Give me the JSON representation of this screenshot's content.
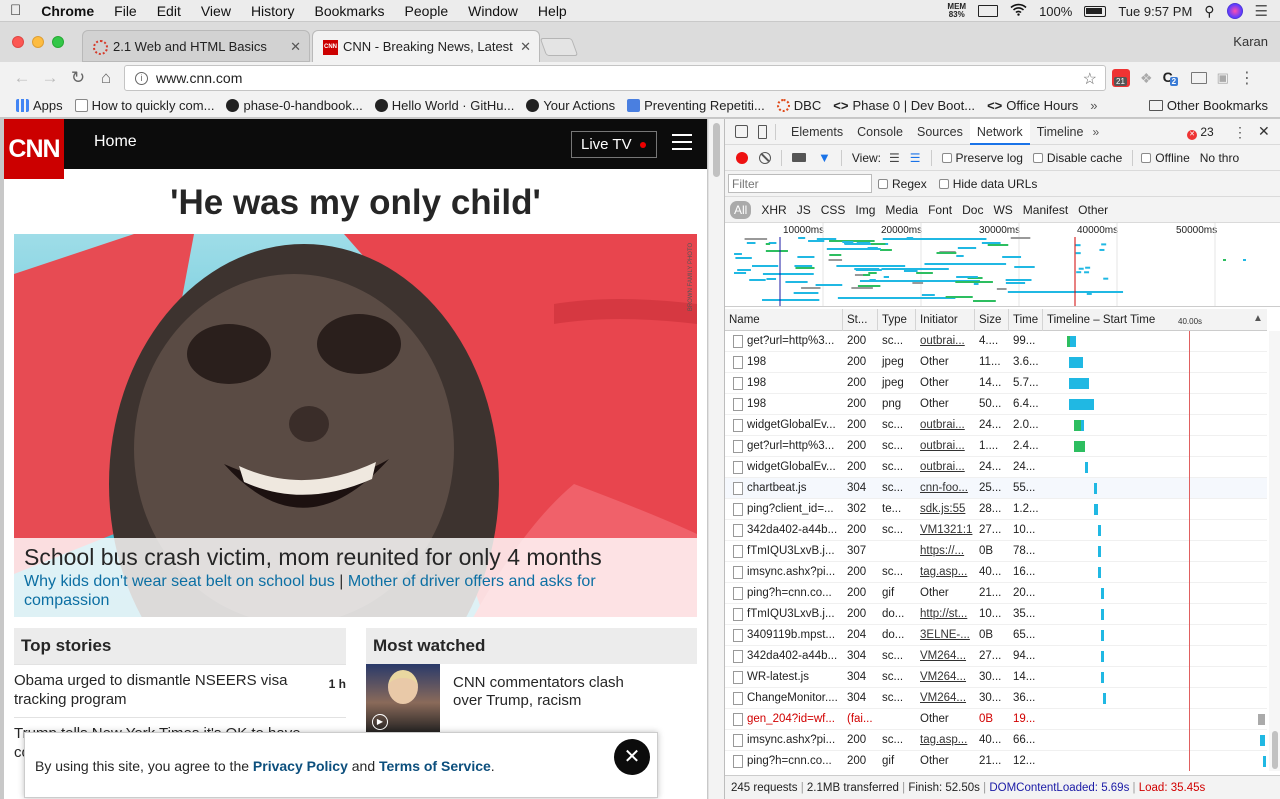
{
  "mac_menu": {
    "app": "Chrome",
    "items": [
      "File",
      "Edit",
      "View",
      "History",
      "Bookmarks",
      "People",
      "Window",
      "Help"
    ],
    "mem_label": "MEM",
    "mem_value": "83%",
    "battery": "100%",
    "clock": "Tue 9:57 PM"
  },
  "tabs": [
    {
      "title": "2.1 Web and HTML Basics",
      "active": false
    },
    {
      "title": "CNN - Breaking News, Latest N",
      "active": true
    }
  ],
  "profile_name": "Karan",
  "address": {
    "url": "www.cnn.com"
  },
  "extensions": {
    "badge_count": "21",
    "second_badge": "2"
  },
  "bookmarks": [
    {
      "label": "Apps",
      "icon": "apps-grid-icon",
      "color": "#4285f4"
    },
    {
      "label": "How to quickly com...",
      "icon": "doc-icon",
      "color": "#888888"
    },
    {
      "label": "phase-0-handbook...",
      "icon": "github-icon",
      "color": "#222222"
    },
    {
      "label": "Hello World · GitHu...",
      "icon": "github-icon",
      "color": "#222222"
    },
    {
      "label": "Your Actions",
      "icon": "github-icon",
      "color": "#222222"
    },
    {
      "label": "Preventing Repetiti...",
      "icon": "google-doc-icon",
      "color": "#4a7fe0"
    },
    {
      "label": "DBC",
      "icon": "dbc-icon",
      "color": "#e04a1a"
    },
    {
      "label": "Phase 0 | Dev Boot...",
      "icon": "code-icon",
      "color": "#333333"
    },
    {
      "label": "Office Hours",
      "icon": "code-icon",
      "color": "#333333"
    }
  ],
  "other_bookmarks": "Other Bookmarks",
  "cnn": {
    "logo": "CNN",
    "nav_home": "Home",
    "live_tv": "Live TV",
    "headline": "'He was my only child'",
    "photo_credit": "BROWN FAMILY PHOTO",
    "caption_title": "School bus crash victim, mom reunited for only 4 months",
    "caption_link1": "Why kids don't wear seat belt on school bus",
    "caption_sep": "|",
    "caption_link2": "Mother of driver offers and asks for compassion",
    "top_stories_title": "Top stories",
    "most_watched_title": "Most watched",
    "stories": [
      {
        "text": "Obama urged to dismantle NSEERS visa tracking program",
        "time": "1 h"
      },
      {
        "text": "Trump tells New York Times it's OK to have co...",
        "time": ""
      }
    ],
    "watched": [
      {
        "text": "CNN commentators clash over Trump, racism"
      }
    ],
    "cookie_prefix": "By using this site, you agree to the ",
    "cookie_policy": "Privacy Policy",
    "cookie_and": " and ",
    "cookie_terms": "Terms of Service",
    "cookie_suffix": "."
  },
  "devtools": {
    "tabs": [
      "Elements",
      "Console",
      "Sources",
      "Network",
      "Timeline"
    ],
    "active_tab": "Network",
    "error_count": "23",
    "view_label": "View:",
    "preserve_log": "Preserve log",
    "disable_cache": "Disable cache",
    "offline": "Offline",
    "throttle": "No thro",
    "filter_placeholder": "Filter",
    "regex": "Regex",
    "hide_data_urls": "Hide data URLs",
    "types": [
      "All",
      "XHR",
      "JS",
      "CSS",
      "Img",
      "Media",
      "Font",
      "Doc",
      "WS",
      "Manifest",
      "Other"
    ],
    "overview_ticks": [
      "10000ms",
      "20000ms",
      "30000ms",
      "40000ms",
      "50000ms"
    ],
    "columns": [
      "Name",
      "St...",
      "Type",
      "Initiator",
      "Size",
      "Time",
      "Timeline – Start Time"
    ],
    "timeline_marker": "40.00s",
    "requests": [
      {
        "name": "get?url=http%3...",
        "status": "200",
        "type": "sc...",
        "initiator": "outbrai...",
        "link": true,
        "size": "4....",
        "time": "99...",
        "wf": [
          {
            "s": 0.11,
            "w": 0.03,
            "c": "#20b8e3"
          },
          {
            "s": 0.1,
            "w": 0.01,
            "c": "#2dbe60"
          }
        ]
      },
      {
        "name": "198",
        "status": "200",
        "type": "jpeg",
        "initiator": "Other",
        "link": false,
        "size": "11...",
        "time": "3.6...",
        "wf": [
          {
            "s": 0.11,
            "w": 0.06,
            "c": "#20b8e3"
          }
        ]
      },
      {
        "name": "198",
        "status": "200",
        "type": "jpeg",
        "initiator": "Other",
        "link": false,
        "size": "14...",
        "time": "5.7...",
        "wf": [
          {
            "s": 0.11,
            "w": 0.09,
            "c": "#20b8e3"
          }
        ]
      },
      {
        "name": "198",
        "status": "200",
        "type": "png",
        "initiator": "Other",
        "link": false,
        "size": "50...",
        "time": "6.4...",
        "wf": [
          {
            "s": 0.11,
            "w": 0.11,
            "c": "#20b8e3"
          }
        ]
      },
      {
        "name": "widgetGlobalEv...",
        "status": "200",
        "type": "sc...",
        "initiator": "outbrai...",
        "link": true,
        "size": "24...",
        "time": "2.0...",
        "wf": [
          {
            "s": 0.13,
            "w": 0.03,
            "c": "#2dbe60"
          },
          {
            "s": 0.16,
            "w": 0.01,
            "c": "#20b8e3"
          }
        ]
      },
      {
        "name": "get?url=http%3...",
        "status": "200",
        "type": "sc...",
        "initiator": "outbrai...",
        "link": true,
        "size": "1....",
        "time": "2.4...",
        "wf": [
          {
            "s": 0.13,
            "w": 0.05,
            "c": "#2dbe60"
          }
        ]
      },
      {
        "name": "widgetGlobalEv...",
        "status": "200",
        "type": "sc...",
        "initiator": "outbrai...",
        "link": true,
        "size": "24...",
        "time": "24...",
        "wf": [
          {
            "s": 0.18,
            "w": 0.01,
            "c": "#20b8e3"
          }
        ]
      },
      {
        "name": "chartbeat.js",
        "status": "304",
        "type": "sc...",
        "initiator": "cnn-foo...",
        "link": true,
        "size": "25...",
        "time": "55...",
        "wf": [
          {
            "s": 0.22,
            "w": 0.01,
            "c": "#20b8e3"
          }
        ]
      },
      {
        "name": "ping?client_id=...",
        "status": "302",
        "type": "te...",
        "initiator": "sdk.js:55",
        "link": true,
        "size": "28...",
        "time": "1.2...",
        "wf": [
          {
            "s": 0.22,
            "w": 0.02,
            "c": "#20b8e3"
          }
        ]
      },
      {
        "name": "342da402-a44b...",
        "status": "200",
        "type": "sc...",
        "initiator": "VM1321:1",
        "link": true,
        "size": "27...",
        "time": "10...",
        "wf": [
          {
            "s": 0.24,
            "w": 0.01,
            "c": "#20b8e3"
          }
        ]
      },
      {
        "name": "fTmIQU3LxvB.j...",
        "status": "307",
        "type": "",
        "initiator": "https://...",
        "link": true,
        "size": "0B",
        "time": "78...",
        "wf": [
          {
            "s": 0.24,
            "w": 0.01,
            "c": "#20b8e3"
          }
        ]
      },
      {
        "name": "imsync.ashx?pi...",
        "status": "200",
        "type": "sc...",
        "initiator": "tag.asp...",
        "link": true,
        "size": "40...",
        "time": "16...",
        "wf": [
          {
            "s": 0.24,
            "w": 0.01,
            "c": "#20b8e3"
          }
        ]
      },
      {
        "name": "ping?h=cnn.co...",
        "status": "200",
        "type": "gif",
        "initiator": "Other",
        "link": false,
        "size": "21...",
        "time": "20...",
        "wf": [
          {
            "s": 0.25,
            "w": 0.01,
            "c": "#20b8e3"
          }
        ]
      },
      {
        "name": "fTmIQU3LxvB.j...",
        "status": "200",
        "type": "do...",
        "initiator": "http://st...",
        "link": true,
        "size": "10...",
        "time": "35...",
        "wf": [
          {
            "s": 0.25,
            "w": 0.01,
            "c": "#20b8e3"
          }
        ]
      },
      {
        "name": "3409119b.mpst...",
        "status": "204",
        "type": "do...",
        "initiator": "3ELNE-...",
        "link": true,
        "size": "0B",
        "time": "65...",
        "wf": [
          {
            "s": 0.25,
            "w": 0.01,
            "c": "#20b8e3"
          }
        ]
      },
      {
        "name": "342da402-a44b...",
        "status": "304",
        "type": "sc...",
        "initiator": "VM264...",
        "link": true,
        "size": "27...",
        "time": "94...",
        "wf": [
          {
            "s": 0.25,
            "w": 0.01,
            "c": "#20b8e3"
          }
        ]
      },
      {
        "name": "WR-latest.js",
        "status": "304",
        "type": "sc...",
        "initiator": "VM264...",
        "link": true,
        "size": "30...",
        "time": "14...",
        "wf": [
          {
            "s": 0.25,
            "w": 0.01,
            "c": "#20b8e3"
          }
        ]
      },
      {
        "name": "ChangeMonitor....",
        "status": "304",
        "type": "sc...",
        "initiator": "VM264...",
        "link": true,
        "size": "30...",
        "time": "36...",
        "wf": [
          {
            "s": 0.26,
            "w": 0.01,
            "c": "#20b8e3"
          }
        ]
      },
      {
        "name": "gen_204?id=wf...",
        "status": "(fai...",
        "type": "",
        "initiator": "Other",
        "link": false,
        "size": "0B",
        "time": "19...",
        "error": true,
        "wf": [
          {
            "s": 0.96,
            "w": 0.03,
            "c": "#aaaaaa"
          }
        ]
      },
      {
        "name": "imsync.ashx?pi...",
        "status": "200",
        "type": "sc...",
        "initiator": "tag.asp...",
        "link": true,
        "size": "40...",
        "time": "66...",
        "wf": [
          {
            "s": 0.97,
            "w": 0.02,
            "c": "#20b8e3"
          }
        ]
      },
      {
        "name": "ping?h=cnn.co...",
        "status": "200",
        "type": "gif",
        "initiator": "Other",
        "link": false,
        "size": "21...",
        "time": "12...",
        "wf": [
          {
            "s": 0.98,
            "w": 0.01,
            "c": "#20b8e3"
          }
        ]
      }
    ],
    "status_requests": "245 requests",
    "status_transferred": "2.1MB transferred",
    "status_finish": "Finish: 52.50s",
    "status_dcl": "DOMContentLoaded: 5.69s",
    "status_load": "Load: 35.45s",
    "colors": {
      "blue": "#20b8e3",
      "green": "#2dbe60",
      "dcl": "#1a1aa6",
      "load": "#d10000",
      "accent": "#1a73e8"
    }
  }
}
